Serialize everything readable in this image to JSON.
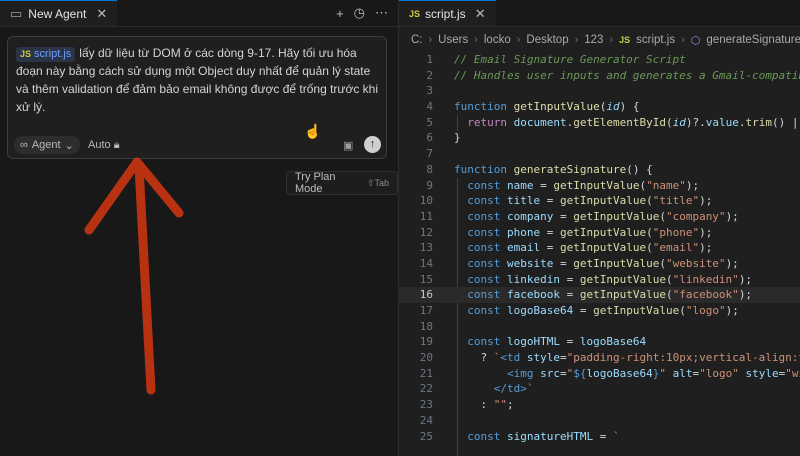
{
  "left_panel": {
    "tab": {
      "label": "New Agent"
    },
    "prompt": {
      "chip_label": "script.js",
      "text": "lấy dữ liệu từ DOM ở các dòng 9-17. Hãy tối ưu hóa đoạn này bằng cách sử dụng một Object duy nhất để quản lý state và thêm validation để đảm bảo email không được để trống trước khi xử lý."
    },
    "mode_label": "Agent",
    "auto_label": "Auto",
    "plan_button": {
      "label": "Try Plan Mode",
      "shortcut": "⇧Tab"
    }
  },
  "editor": {
    "tab_label": "script.js",
    "breadcrumb": [
      "C:",
      "Users",
      "locko",
      "Desktop",
      "123",
      "script.js",
      "generateSignature"
    ],
    "current_line": 16,
    "line_numbers": [
      "1",
      "2",
      "3",
      "4",
      "5",
      "6",
      "7",
      "8",
      "9",
      "10",
      "11",
      "12",
      "13",
      "14",
      "15",
      "16",
      "17",
      "18",
      "19",
      "20",
      "21",
      "22",
      "23",
      "24",
      "25"
    ]
  },
  "colors": {
    "accent": "#0078d4",
    "arrow": "#b83212"
  }
}
